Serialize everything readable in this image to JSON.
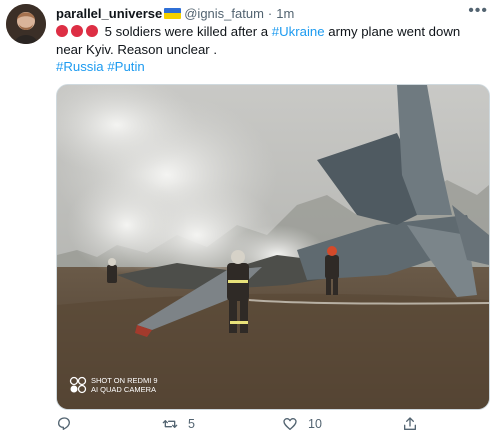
{
  "user": {
    "display_name": "parallel_universe",
    "handle": "@ignis_fatum",
    "separator": "·",
    "time": "1m"
  },
  "tweet": {
    "text_main": "5 soldiers were killed after a ",
    "tag_ukraine": "#Ukraine",
    "text_rest": " army plane went down near Kyiv. Reason unclear .",
    "tag_russia": "#Russia",
    "tag_putin": "#Putin"
  },
  "media": {
    "watermark_line1": "SHOT ON REDMI 9",
    "watermark_line2": "AI QUAD CAMERA"
  },
  "actions": {
    "retweets": "5",
    "likes": "10"
  },
  "icons": {
    "more": "more-icon",
    "reply": "reply-icon",
    "retweet": "retweet-icon",
    "like": "heart-icon",
    "share": "share-icon"
  },
  "colors": {
    "link": "#1d9bf0",
    "secondary": "#536471",
    "emoji_red": "#dd2e44"
  }
}
